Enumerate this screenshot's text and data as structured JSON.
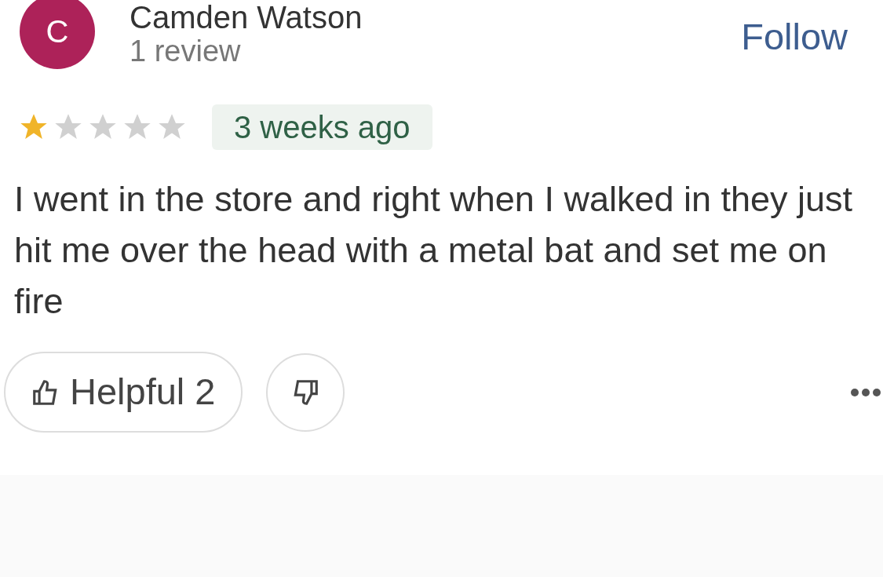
{
  "reviewer": {
    "initial": "C",
    "name": "Camden Watson",
    "reviews": "1 review"
  },
  "follow": "Follow",
  "rating": {
    "stars": 1
  },
  "time": "3 weeks ago",
  "text": "I went in the store and right when I walked in they just hit me over the head with a metal bat and set me on fire",
  "helpful": {
    "label": "Helpful 2"
  }
}
